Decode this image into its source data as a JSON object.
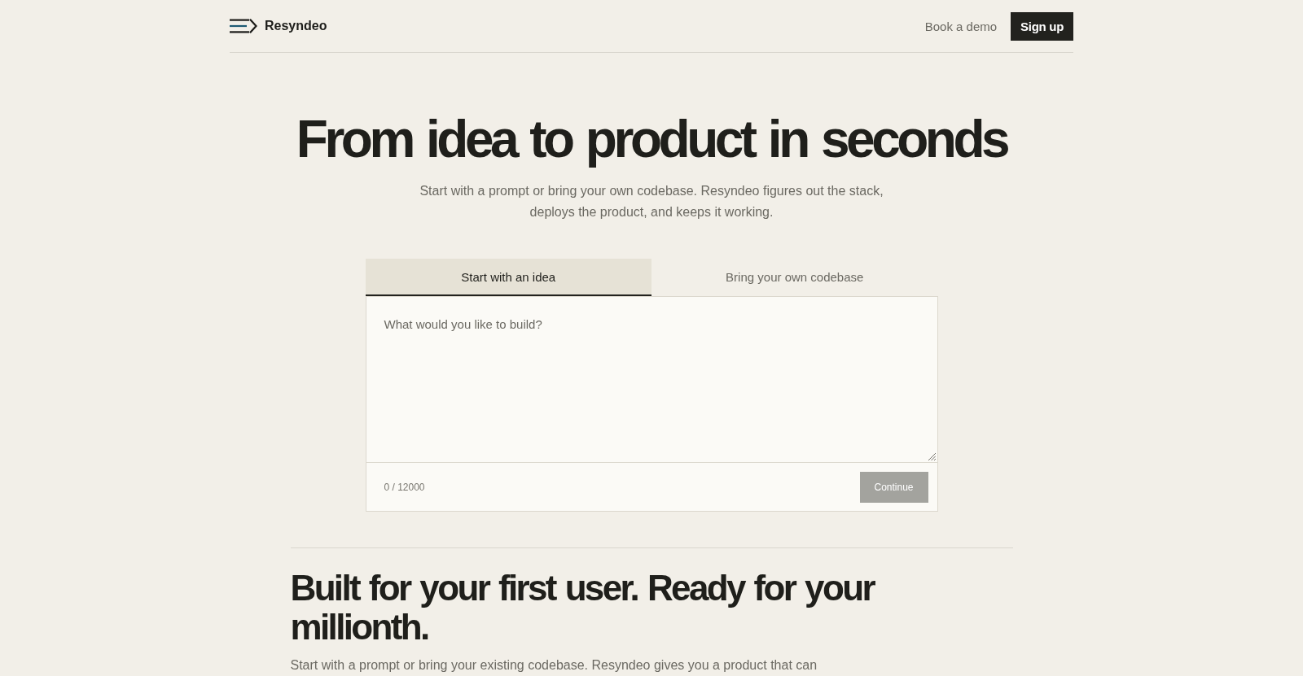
{
  "header": {
    "brand": "Resyndeo",
    "actions": [
      {
        "label": "Book a demo",
        "kind": "link"
      },
      {
        "label": "Sign up",
        "kind": "button"
      }
    ]
  },
  "hero": {
    "title": "From idea to product in seconds",
    "subtitle": "Start with a prompt or bring your own codebase. Resyndeo figures out the stack, deploys the product, and keeps it working."
  },
  "prompt": {
    "tabs": [
      {
        "label": "Start with an idea",
        "selected": true
      },
      {
        "label": "Bring your own codebase",
        "selected": false
      }
    ],
    "placeholder": "What would you like to build?",
    "counter": "0 / 12000",
    "continue_button": {
      "label": "Continue",
      "disabled": true
    }
  },
  "section": {
    "heading": "Built for your first user. Ready for your millionth.",
    "text": "Start with a prompt or bring your existing codebase. Resyndeo gives you a product that can"
  }
}
